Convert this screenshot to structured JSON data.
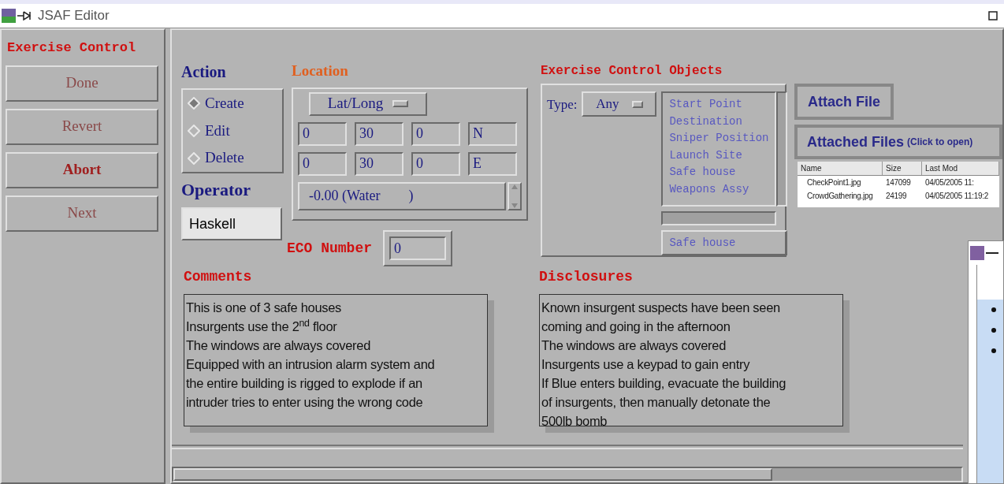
{
  "window": {
    "title": "JSAF Editor"
  },
  "sidebar": {
    "title": "Exercise Control",
    "buttons": [
      {
        "label": "Done",
        "disabled": true
      },
      {
        "label": "Revert",
        "disabled": true
      },
      {
        "label": "Abort",
        "disabled": false
      },
      {
        "label": "Next",
        "disabled": true
      }
    ]
  },
  "action": {
    "label": "Action",
    "options": [
      {
        "label": "Create",
        "selected": true
      },
      {
        "label": "Edit",
        "selected": false
      },
      {
        "label": "Delete",
        "selected": false
      }
    ]
  },
  "operator": {
    "label": "Operator",
    "value": "Haskell"
  },
  "location": {
    "label": "Location",
    "format": "Lat/Long",
    "rows": [
      [
        "0",
        "30",
        "0",
        "N"
      ],
      [
        "0",
        "30",
        "0",
        "E"
      ]
    ],
    "elevation": "-0.00 (Water        )"
  },
  "eco_number": {
    "label": "ECO Number",
    "value": "0"
  },
  "objects": {
    "label": "Exercise Control Objects",
    "type_label": "Type:",
    "type_value": "Any",
    "items": [
      "Start Point",
      "Destination",
      "Sniper Position",
      "Launch Site",
      "Safe house",
      "Weapons Assy"
    ],
    "selection": "Safe house"
  },
  "attach_button": "Attach File",
  "attached_files": {
    "title": "Attached Files",
    "hint": "(Click to open)",
    "columns": [
      "Name",
      "Size",
      "Last Mod"
    ],
    "rows": [
      [
        "CheckPoint1.jpg",
        "147099",
        "04/05/2005 11:"
      ],
      [
        "CrowdGathering.jpg",
        "24199",
        "04/05/2005 11:19:2"
      ]
    ]
  },
  "comments": {
    "label": "Comments",
    "lines": [
      "This is one of 3 safe houses",
      "Insurgents use the 2$^{nd}$ floor",
      "The windows are always covered",
      "Equipped with an intrusion alarm system and",
      "the entire building is rigged to explode if an",
      "intruder tries to enter using the wrong code"
    ]
  },
  "disclosures": {
    "label": "Disclosures",
    "lines": [
      "Known insurgent suspects have been seen",
      "coming and going in the afternoon",
      "The windows are always covered",
      "Insurgents use a keypad to gain entry",
      "If Blue enters building, evacuate the building",
      "of insurgents, then manually detonate the",
      "500lb bomb"
    ]
  }
}
